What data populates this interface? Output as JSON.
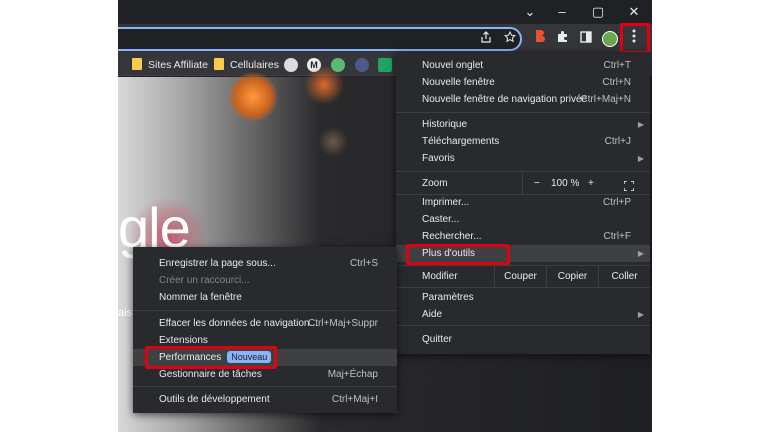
{
  "window": {
    "minimize_glyph": "⌄",
    "minimize2_glyph": "–",
    "maximize_glyph": "▢",
    "close_glyph": "✕"
  },
  "bookmarks": {
    "items": [
      {
        "label": "Sites Affiliate"
      },
      {
        "label": "Cellulaires"
      }
    ]
  },
  "page": {
    "logo_fragment": "gle",
    "side_fragment": "ais"
  },
  "main_menu": {
    "new_tab": {
      "label": "Nouvel onglet",
      "shortcut": "Ctrl+T"
    },
    "new_window": {
      "label": "Nouvelle fenêtre",
      "shortcut": "Ctrl+N"
    },
    "incognito": {
      "label": "Nouvelle fenêtre de navigation privée",
      "shortcut": "Ctrl+Maj+N"
    },
    "history": {
      "label": "Historique"
    },
    "downloads": {
      "label": "Téléchargements",
      "shortcut": "Ctrl+J"
    },
    "favorites": {
      "label": "Favoris"
    },
    "zoom": {
      "label": "Zoom",
      "minus": "−",
      "value": "100 %",
      "plus": "+"
    },
    "print": {
      "label": "Imprimer...",
      "shortcut": "Ctrl+P"
    },
    "cast": {
      "label": "Caster..."
    },
    "find": {
      "label": "Rechercher...",
      "shortcut": "Ctrl+F"
    },
    "more_tools": {
      "label": "Plus d'outils"
    },
    "edit": {
      "label": "Modifier",
      "cut": "Couper",
      "copy": "Copier",
      "paste": "Coller"
    },
    "settings": {
      "label": "Paramètres"
    },
    "help": {
      "label": "Aide"
    },
    "quit": {
      "label": "Quitter"
    }
  },
  "sub_menu": {
    "save_page": {
      "label": "Enregistrer la page sous...",
      "shortcut": "Ctrl+S"
    },
    "create_shortcut": {
      "label": "Créer un raccourci..."
    },
    "name_window": {
      "label": "Nommer la fenêtre"
    },
    "clear_data": {
      "label": "Effacer les données de navigation...",
      "shortcut": "Ctrl+Maj+Suppr"
    },
    "extensions": {
      "label": "Extensions"
    },
    "performance": {
      "label": "Performances",
      "badge": "Nouveau"
    },
    "task_manager": {
      "label": "Gestionnaire de tâches",
      "shortcut": "Maj+Échap"
    },
    "dev_tools": {
      "label": "Outils de développement",
      "shortcut": "Ctrl+Maj+I"
    }
  },
  "colors": {
    "highlight_box": "#e0000f",
    "menu_bg": "#292a2d",
    "accent": "#8ab4f8"
  }
}
